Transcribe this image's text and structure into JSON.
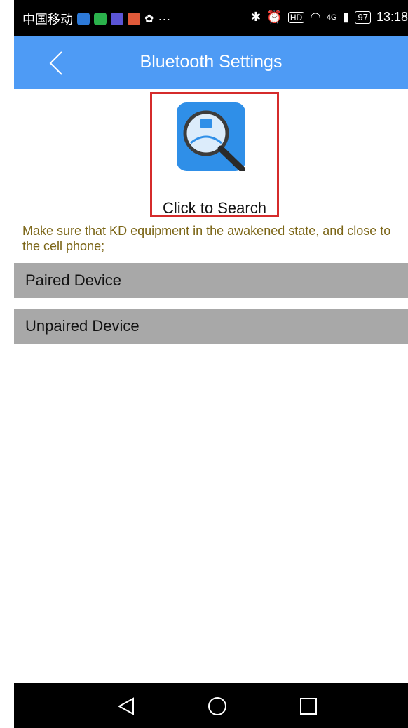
{
  "status_bar": {
    "carrier": "中国移动",
    "network": "4G",
    "battery": "97",
    "time": "13:18"
  },
  "header": {
    "title": "Bluetooth Settings"
  },
  "search": {
    "label": "Click to Search"
  },
  "hint": "Make sure that KD equipment in the awakened state, and close to the cell phone;",
  "sections": {
    "paired": "Paired Device",
    "unpaired": "Unpaired Device"
  },
  "colors": {
    "header": "#4e9bf5",
    "section": "#a8a8a8",
    "hint": "#7b6516",
    "highlight": "#d52b2b"
  },
  "icons": {
    "back": "chevron-left-icon",
    "search_app": "magnifier-car-icon",
    "nav_back": "triangle-back-icon",
    "nav_home": "circle-home-icon",
    "nav_recent": "square-recent-icon"
  }
}
